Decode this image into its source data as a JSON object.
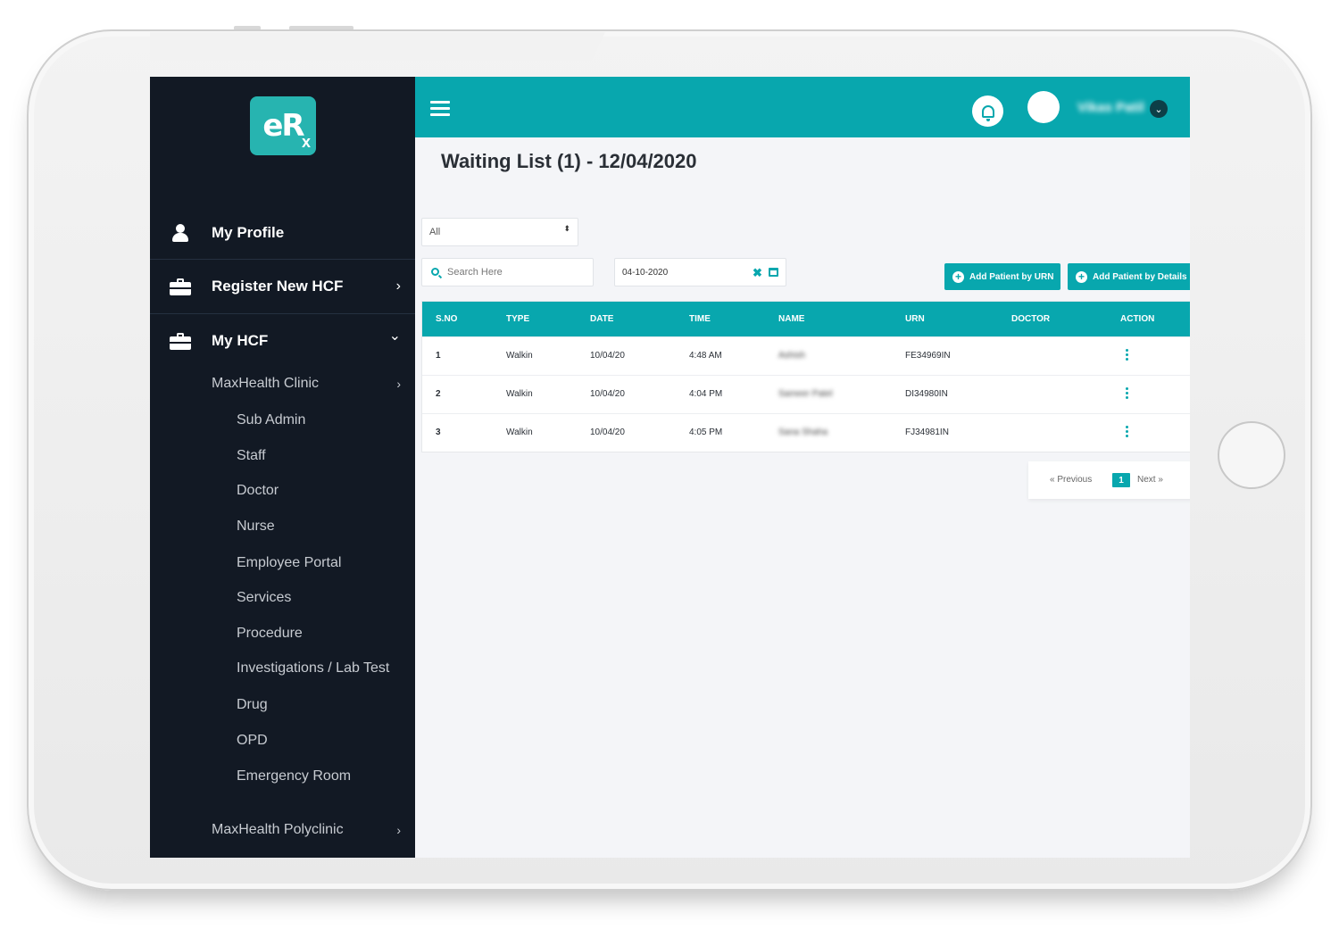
{
  "sidebar": {
    "logo": "eR",
    "logo_sub": "x",
    "items": [
      {
        "label": "My Profile",
        "icon": "user-icon"
      },
      {
        "label": "Register New HCF",
        "icon": "briefcase-icon",
        "chevron": "›"
      },
      {
        "label": "My HCF",
        "icon": "briefcase-icon",
        "chevron": "⌄"
      }
    ],
    "clinic1": {
      "label": "MaxHealth Clinic",
      "chevron": "›"
    },
    "clinic1_items": [
      "Sub Admin",
      "Staff",
      "Doctor",
      "Nurse",
      "Employee Portal",
      "Services",
      "Procedure",
      "Investigations / Lab Test",
      "Drug",
      "OPD",
      "Emergency Room"
    ],
    "clinic2": {
      "label": "MaxHealth Polyclinic",
      "chevron": "›"
    }
  },
  "topbar": {
    "username": "Vikas Patil",
    "caret": "⌄"
  },
  "page": {
    "title": "Waiting List (1) - 12/04/2020"
  },
  "filters": {
    "type_selected": "All",
    "type_arrows": "⬍",
    "search_placeholder": "Search Here",
    "date_value": "04-10-2020",
    "date_clear": "✖"
  },
  "buttons": {
    "add_by_urn": "Add Patient by URN",
    "add_by_details": "Add Patient by Details",
    "plus": "+"
  },
  "table": {
    "headers": [
      "S.NO",
      "TYPE",
      "DATE",
      "TIME",
      "NAME",
      "URN",
      "DOCTOR",
      "ACTION"
    ],
    "rows": [
      {
        "sno": "1",
        "type": "Walkin",
        "date": "10/04/20",
        "time": "4:48 AM",
        "name": "Ashish",
        "urn": "FE34969IN",
        "doctor": ""
      },
      {
        "sno": "2",
        "type": "Walkin",
        "date": "10/04/20",
        "time": "4:04 PM",
        "name": "Sameer Patel",
        "urn": "DI34980IN",
        "doctor": ""
      },
      {
        "sno": "3",
        "type": "Walkin",
        "date": "10/04/20",
        "time": "4:05 PM",
        "name": "Sana Shaha",
        "urn": "FJ34981IN",
        "doctor": ""
      }
    ]
  },
  "pagination": {
    "previous": "«  Previous",
    "current": "1",
    "next": "Next  »"
  },
  "colors": {
    "accent": "#08a7ae",
    "sidebar": "#121924",
    "logo": "#27b4b0"
  }
}
